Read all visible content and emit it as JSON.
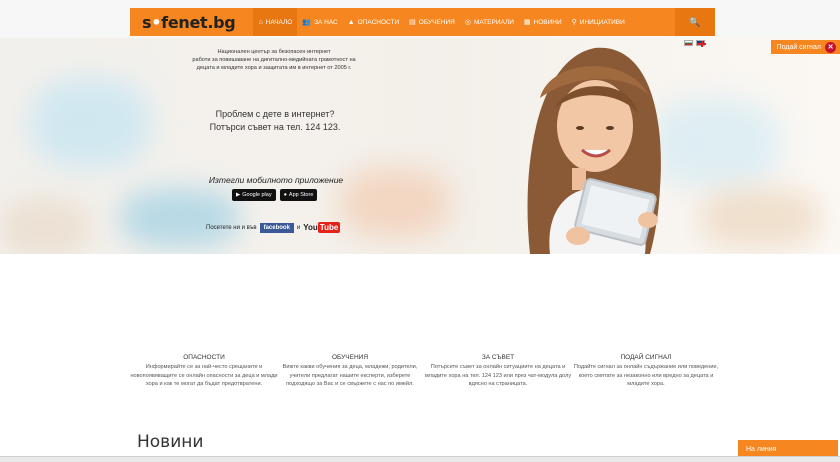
{
  "nav": {
    "logo_prefix": "s",
    "logo_dot": "•",
    "logo_suffix": "fenet.bg",
    "items": [
      {
        "label": "НАЧАЛО",
        "icon": "home-icon",
        "glyph": "⌂"
      },
      {
        "label": "ЗА НАС",
        "icon": "users-icon",
        "glyph": "👥"
      },
      {
        "label": "ОПАСНОСТИ",
        "icon": "warning-icon",
        "glyph": "▲"
      },
      {
        "label": "ОБУЧЕНИЯ",
        "icon": "book-icon",
        "glyph": "▤"
      },
      {
        "label": "МАТЕРИАЛИ",
        "icon": "materials-icon",
        "glyph": "◎"
      },
      {
        "label": "НОВИНИ",
        "icon": "news-icon",
        "glyph": "▦"
      },
      {
        "label": "ИНИЦИАТИВИ",
        "icon": "pin-icon",
        "glyph": "⚲"
      }
    ],
    "search_glyph": "🔍"
  },
  "hero": {
    "intro_line1": "Национален център за безопасен интернет",
    "intro_line2": "работи за повишаване на дигитално-медийната грамотност на",
    "intro_line3": "децата и младите хора и защитата им в интернет от 2005 г.",
    "help_line1": "Проблем с дете в интернет?",
    "help_line2": "Потърси съвет на тел. 124 123.",
    "app_title": "Изтегли мобилното приложение",
    "google_play": "Google play",
    "app_store": "App Store",
    "visit_text": "Посетете ни и във",
    "facebook": "facebook",
    "and": "и",
    "youtube_you": "You",
    "youtube_tube": "Tube",
    "report_tab": "Подай сигнал",
    "report_x": "✕"
  },
  "features": [
    {
      "title": "ОПАСНОСТИ",
      "desc": "Информирайте се за най-често срещаните и новопоявяващите се онлайн опасности за деца и млади хора и как те могат да бъдат предотвратени."
    },
    {
      "title": "ОБУЧЕНИЯ",
      "desc": "Вижте какви обучения за деца, младежи, родители, учители предлагат нашите експерти, изберете подходящо за Вас и се свържете с нас по имейл."
    },
    {
      "title": "ЗА СЪВЕТ",
      "desc": "Потърсете съвет за онлайн ситуациите на децата и младите хора на тел. 124 123 или през чат-модула долу вдясно на страницата."
    },
    {
      "title": "ПОДАЙ СИГНАЛ",
      "desc": "Подайте сигнал за онлайн съдържание или поведение, което смятате за незаконно или вредно за децата и младите хора."
    }
  ],
  "news_title": "Новини",
  "chat_tab": "На линия",
  "colors": {
    "accent": "#f6861f",
    "accent_dark": "#e87712",
    "danger": "#c8102e",
    "facebook": "#3b5998"
  }
}
